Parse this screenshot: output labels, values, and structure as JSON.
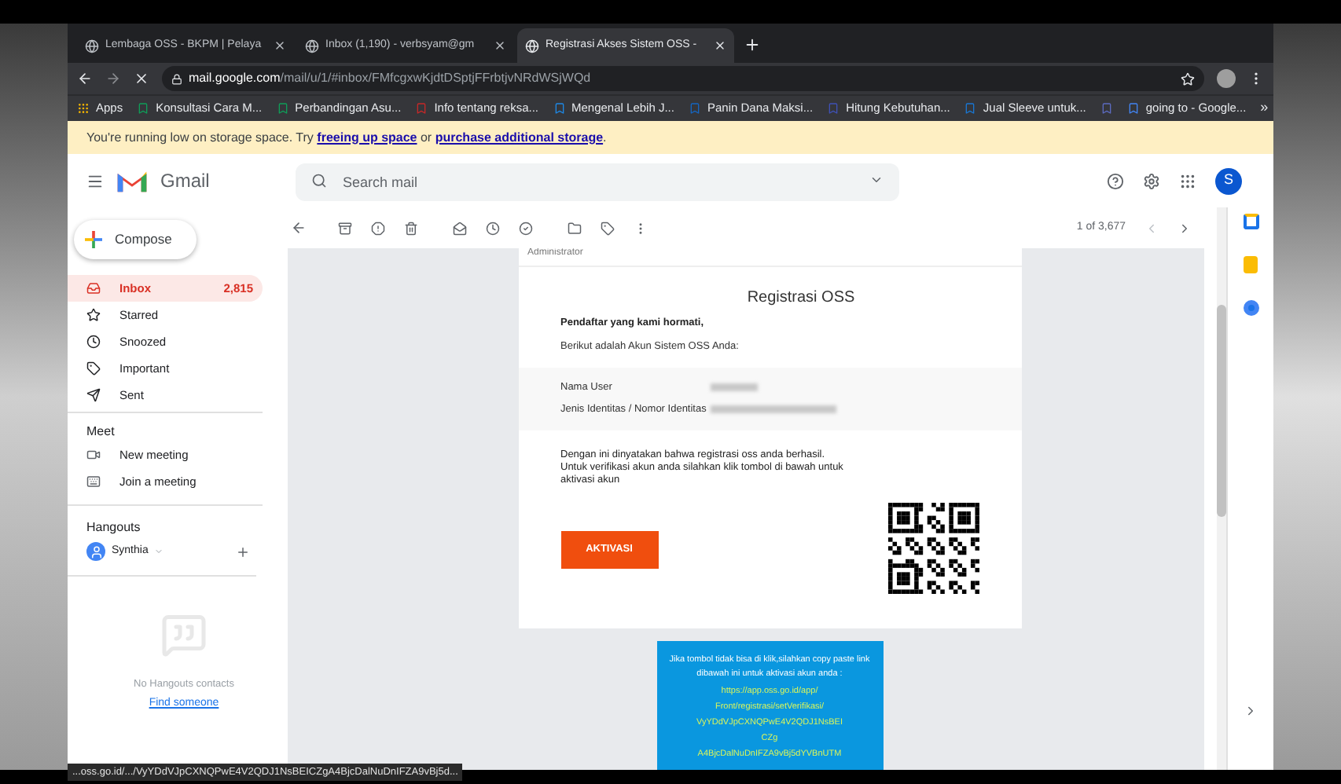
{
  "browser": {
    "tabs": [
      {
        "title": "Lembaga OSS - BKPM | Pelaya",
        "selected": false
      },
      {
        "title": "Inbox (1,190) - verbsyam@gm",
        "selected": false
      },
      {
        "title": "Registrasi Akses Sistem OSS -",
        "selected": true
      }
    ],
    "address": {
      "host": "mail.google.com",
      "path": "/mail/u/1/#inbox/FMfcgxwKjdtDSptjFFrbtjvNRdWSjWQd"
    },
    "bookmarks": [
      {
        "kind": "apps",
        "label": "Apps"
      },
      {
        "kind": "link",
        "label": "Konsultasi Cara M..."
      },
      {
        "kind": "link",
        "label": "Perbandingan Asu..."
      },
      {
        "kind": "link",
        "label": "Info tentang reksa..."
      },
      {
        "kind": "link",
        "label": "Mengenal Lebih J..."
      },
      {
        "kind": "link",
        "label": "Panin Dana Maksi..."
      },
      {
        "kind": "link",
        "label": "Hitung Kebutuhan..."
      },
      {
        "kind": "link",
        "label": "Jual Sleeve untuk..."
      },
      {
        "kind": "icon"
      },
      {
        "kind": "link",
        "label": "going to - Google..."
      }
    ],
    "bookmarks_more": "»",
    "status_link": "...oss.go.id/.../VyYDdVJpCXNQPwE4V2QDJ1NsBEICZgA4BjcDalNuDnIFZA9vBj5d..."
  },
  "storage_banner": {
    "before": "You're running low on storage space. Try",
    "link_1": "freeing up space",
    "middle": "or",
    "link_2": "purchase additional storage",
    "after": "."
  },
  "gmail": {
    "logo": "Gmail",
    "search": {
      "placeholder": "Search mail"
    },
    "account_initial": "S",
    "compose": "Compose",
    "folders": [
      {
        "label": "Inbox",
        "count": "2,815",
        "selected": true
      },
      {
        "label": "Starred",
        "selected": false
      },
      {
        "label": "Snoozed",
        "selected": false
      },
      {
        "label": "Important",
        "selected": false
      },
      {
        "label": "Sent",
        "selected": false
      }
    ],
    "meet": {
      "heading": "Meet",
      "items": [
        "New meeting",
        "Join a meeting"
      ]
    },
    "hangouts": {
      "heading": "Hangouts",
      "user": "Synthia",
      "empty": "No Hangouts contacts",
      "find": "Find someone"
    },
    "pager": "1 of 3,677"
  },
  "email": {
    "sender_line": "Administrator",
    "title": "Registrasi OSS",
    "greeting": "Pendaftar yang kami hormati,",
    "intro": "Berikut adalah Akun Sistem OSS Anda:",
    "fields": [
      {
        "label": "Nama User"
      },
      {
        "label": "Jenis Identitas / Nomor Identitas"
      }
    ],
    "message": "Dengan ini dinyatakan bahwa registrasi oss anda berhasil. Untuk verifikasi akun anda silahkan klik tombol di bawah untuk aktivasi akun",
    "button": "AKTIVASI",
    "fallback": {
      "text": "Jika tombol tidak bisa di klik,silahkan copy paste link dibawah ini untuk aktivasi akun anda :",
      "link_lines": [
        "https://app.oss.go.id/app/",
        "Front/registrasi/setVerifikasi/",
        "VyYDdVJpCXNQPwE4V2QDJ1NsBEI",
        "CZg",
        "A4BjcDalNuDnIFZA9vBj5dYVBnUTM"
      ]
    }
  }
}
